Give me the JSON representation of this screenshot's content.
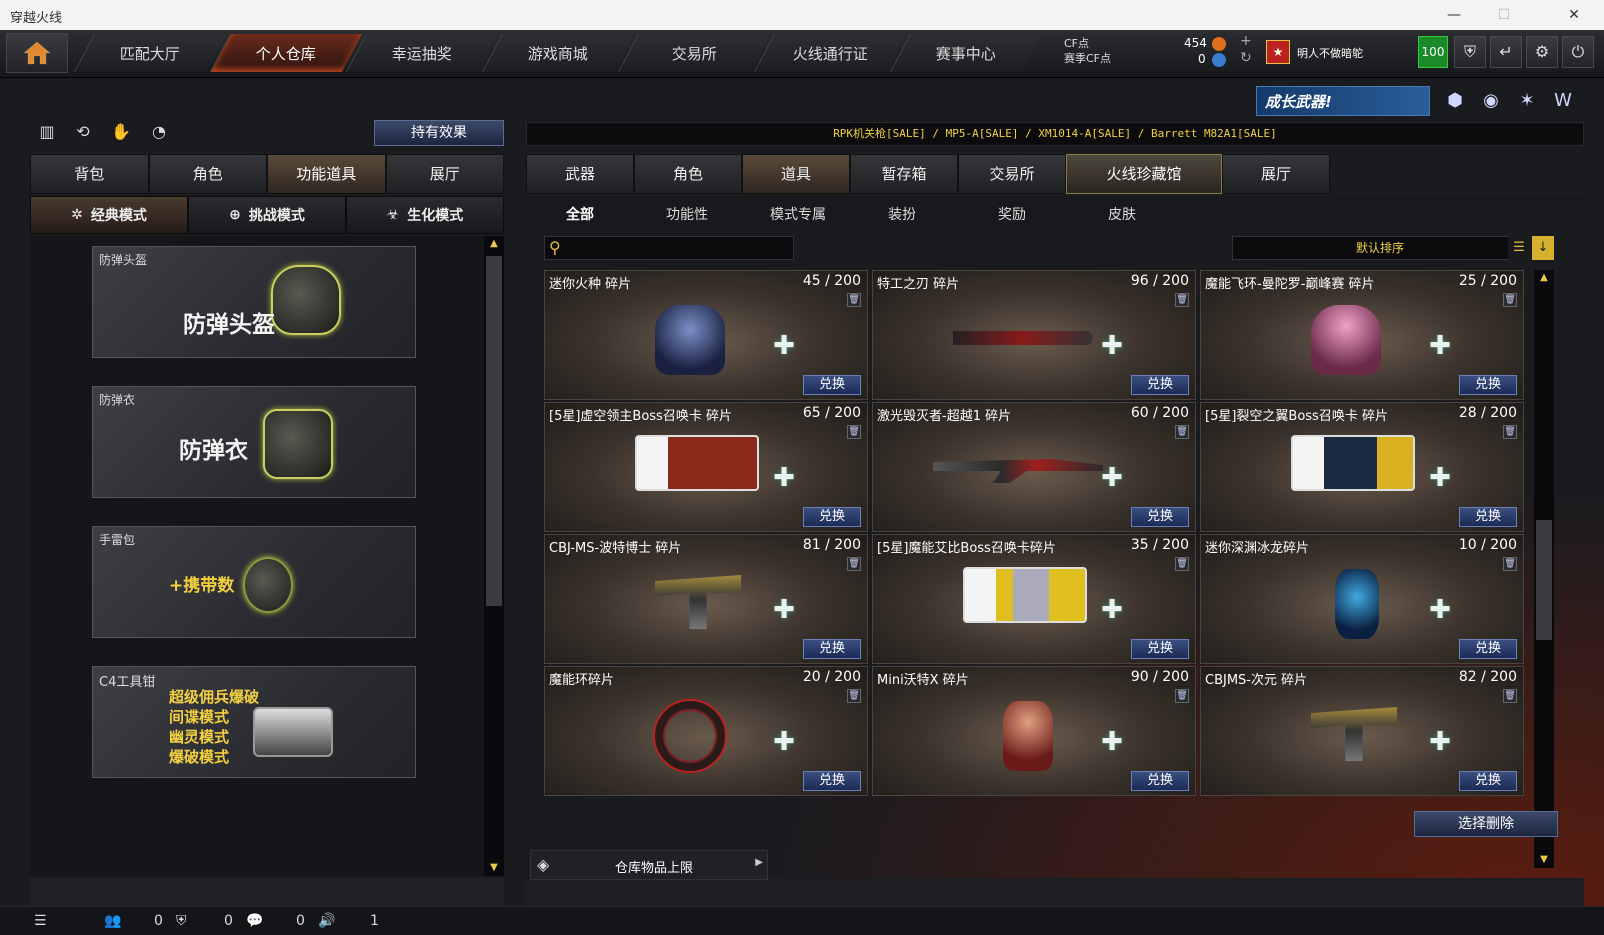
{
  "window": {
    "title": "穿越火线",
    "controls": [
      "—",
      "☐",
      "✕"
    ]
  },
  "nav": {
    "tabs": [
      "匹配大厅",
      "个人仓库",
      "幸运抽奖",
      "游戏商城",
      "交易所",
      "火线通行证",
      "赛事中心"
    ],
    "active_index": 1
  },
  "account": {
    "cf_label": "CF点",
    "cf_value": "454",
    "season_label": "赛季CF点",
    "season_value": "0",
    "username": "明人不做暗鸵",
    "level": "100"
  },
  "banner": {
    "text": "成长武器!"
  },
  "left": {
    "effect_button": "持有效果",
    "tabs": [
      "背包",
      "角色",
      "功能道具",
      "展厅"
    ],
    "active_tab": 2,
    "modes": [
      "经典模式",
      "挑战模式",
      "生化模式"
    ],
    "active_mode": 0,
    "items": [
      {
        "label": "防弹头盔",
        "big": "防弹头盔"
      },
      {
        "label": "防弹衣",
        "big": "防弹衣"
      },
      {
        "label": "手雷包",
        "big": "+携带数"
      },
      {
        "label": "C4工具钳",
        "lines": [
          "超级佣兵爆破",
          "间谍模式",
          "幽灵模式",
          "爆破模式"
        ]
      }
    ]
  },
  "right": {
    "sale_text": "RPK机关枪[SALE] / MP5-A[SALE] / XM1014-A[SALE] / Barrett M82A1[SALE]",
    "tabs": [
      "武器",
      "角色",
      "道具",
      "暂存箱",
      "交易所",
      "火线珍藏馆",
      "展厅"
    ],
    "active_tab": 2,
    "special_tab": 5,
    "subtabs": [
      "全部",
      "功能性",
      "模式专属",
      "装扮",
      "奖励",
      "皮肤"
    ],
    "active_subtab": 0,
    "search_placeholder": "",
    "sort_label": "默认排序",
    "exchange_label": "兑换",
    "cards": [
      {
        "name": "迷你火种 碎片",
        "qty": "45 / 200"
      },
      {
        "name": "特工之刃 碎片",
        "qty": "96 / 200"
      },
      {
        "name": "魔能飞环-曼陀罗-巅峰赛 碎片",
        "qty": "25 / 200"
      },
      {
        "name": "[5星]虚空领主Boss召唤卡 碎片",
        "qty": "65 / 200"
      },
      {
        "name": "激光毁灭者-超越1 碎片",
        "qty": "60 / 200"
      },
      {
        "name": "[5星]裂空之翼Boss召唤卡 碎片",
        "qty": "28 / 200"
      },
      {
        "name": "CBJ-MS-波特博士 碎片",
        "qty": "81 / 200"
      },
      {
        "name": "[5星]魔能艾比Boss召唤卡碎片",
        "qty": "35 / 200"
      },
      {
        "name": "迷你深渊冰龙碎片",
        "qty": "10 / 200"
      },
      {
        "name": "魔能环碎片",
        "qty": "20 / 200"
      },
      {
        "name": "Mini沃特X 碎片",
        "qty": "90 / 200"
      },
      {
        "name": "CBJMS-次元 碎片",
        "qty": "82 / 200"
      }
    ],
    "delete_button": "选择删除",
    "storage_label": "仓库物品上限"
  },
  "status": {
    "friends": "0",
    "clan": "0",
    "chat": "0",
    "volume": "1"
  },
  "colors": {
    "accent": "#e8c040",
    "button_blue": "#2a3a68",
    "active_nav": "#c24a20",
    "level_green": "#1a8a2a"
  }
}
